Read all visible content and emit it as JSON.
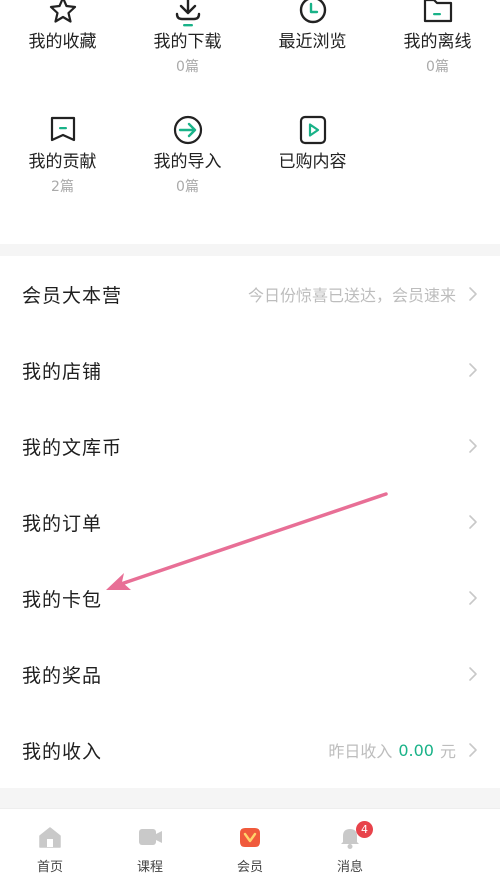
{
  "grid": {
    "items": [
      {
        "label": "我的收藏",
        "count": "",
        "icon": "star-icon"
      },
      {
        "label": "我的下载",
        "count": "0篇",
        "icon": "download-icon"
      },
      {
        "label": "最近浏览",
        "count": "",
        "icon": "clock-icon"
      },
      {
        "label": "我的离线",
        "count": "0篇",
        "icon": "folder-icon"
      },
      {
        "label": "我的贡献",
        "count": "2篇",
        "icon": "contribution-icon"
      },
      {
        "label": "我的导入",
        "count": "0篇",
        "icon": "import-icon"
      },
      {
        "label": "已购内容",
        "count": "",
        "icon": "purchased-icon"
      }
    ]
  },
  "menu": {
    "items": [
      {
        "label": "会员大本营",
        "hint": "今日份惊喜已送达，会员速来"
      },
      {
        "label": "我的店铺"
      },
      {
        "label": "我的文库币"
      },
      {
        "label": "我的订单"
      },
      {
        "label": "我的卡包"
      },
      {
        "label": "我的奖品"
      },
      {
        "label": "我的收入",
        "hint_prefix": "昨日收入",
        "hint_value": "0.00",
        "hint_suffix": "元"
      }
    ]
  },
  "tabbar": {
    "tabs": [
      {
        "label": "首页",
        "icon": "home-icon"
      },
      {
        "label": "课程",
        "icon": "video-icon"
      },
      {
        "label": "会员",
        "icon": "vip-icon"
      },
      {
        "label": "消息",
        "icon": "bell-icon",
        "badge": "4"
      }
    ]
  },
  "colors": {
    "accent": "#19b288",
    "annotation_arrow": "#e86f96",
    "badge": "#e8434b"
  }
}
